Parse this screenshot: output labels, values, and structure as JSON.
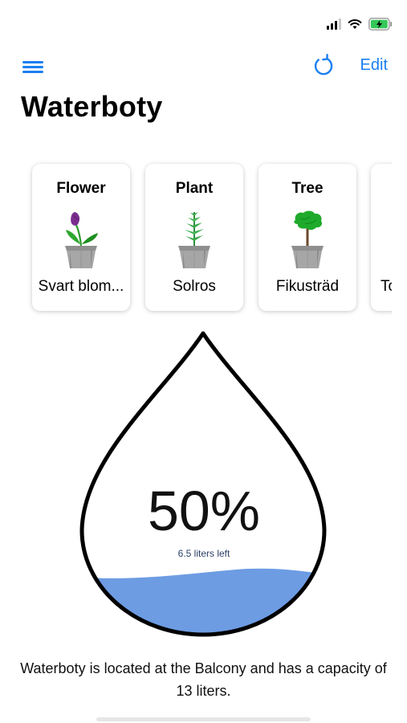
{
  "status_bar": {
    "signal_icon": "cellular-signal-icon",
    "wifi_icon": "wifi-icon",
    "battery_icon": "battery-charging-icon",
    "battery_color": "#34c759"
  },
  "nav": {
    "menu_icon": "hamburger-menu-icon",
    "refresh_icon": "refresh-icon",
    "edit_label": "Edit",
    "accent_color": "#1a7ff0"
  },
  "page": {
    "title": "Waterboty"
  },
  "plants": [
    {
      "type": "Flower",
      "name": "Svart blom...",
      "icon": "tulip-pot-icon"
    },
    {
      "type": "Plant",
      "name": "Solros",
      "icon": "sprout-pot-icon"
    },
    {
      "type": "Tree",
      "name": "Fikusträd",
      "icon": "tree-pot-icon"
    },
    {
      "type": "",
      "name": "To",
      "icon": ""
    }
  ],
  "water_level": {
    "percent_label": "50%",
    "fill_fraction": 0.5,
    "liters_left": "6.5 liters left",
    "water_color": "#6d9ce3"
  },
  "description": "Waterboty is located at the Balcony and has a capacity of 13 liters."
}
